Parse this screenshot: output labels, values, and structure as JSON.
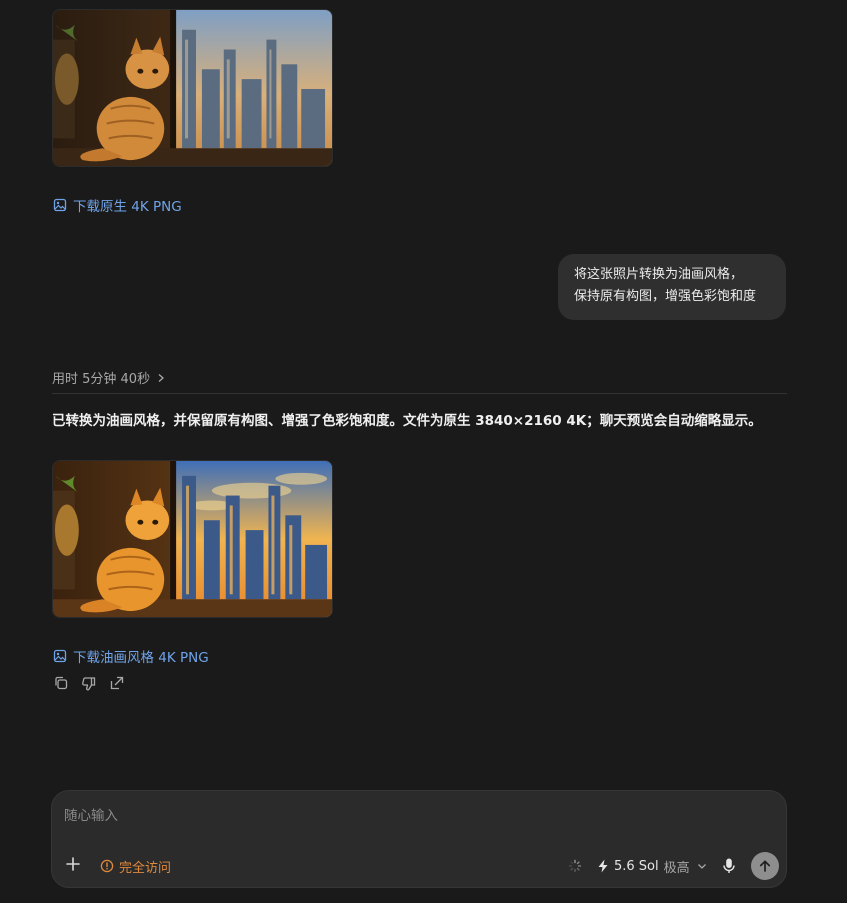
{
  "first_result": {
    "download_label": "下载原生 4K PNG",
    "download_icon": "image-icon"
  },
  "user_message": {
    "line1": "将这张照片转换为油画风格，",
    "line2": "保持原有构图，增强色彩饱和度"
  },
  "thinking": {
    "label": "用时 5分钟 40秒",
    "chevron_icon": "chevron-right-icon"
  },
  "assistant_reply": {
    "text": "已转换为油画风格，并保留原有构图、增强了色彩饱和度。文件为原生 3840×2160 4K；聊天预览会自动缩略显示。",
    "download_label": "下载油画风格 4K PNG",
    "download_icon": "image-icon",
    "actions": [
      "copy-icon",
      "thumbs-down-icon",
      "share-icon"
    ]
  },
  "composer": {
    "placeholder": "随心输入",
    "access_label": "完全访问",
    "model_name": "5.6 Sol",
    "effort": "极高"
  },
  "colors": {
    "background": "#1a1a1a",
    "link": "#6fa3e8",
    "warning": "#e08a3c",
    "bubble": "#2f2f2f"
  }
}
